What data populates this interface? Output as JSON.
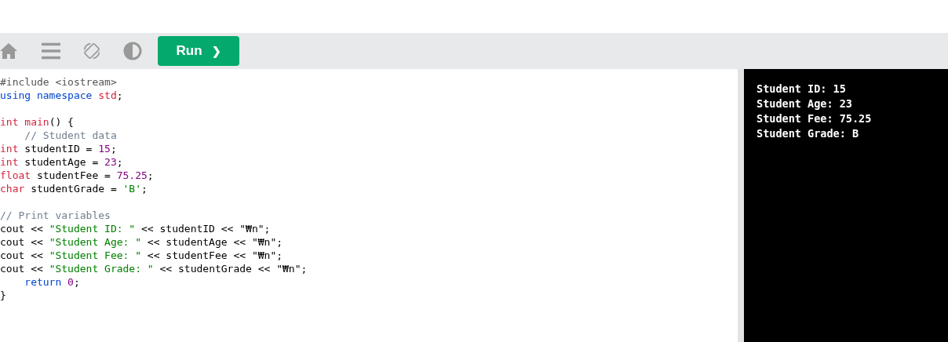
{
  "toolbar": {
    "buttons": [
      {
        "kind": "home"
      },
      {
        "kind": "menu"
      },
      {
        "kind": "rotate"
      },
      {
        "kind": "contrast"
      }
    ],
    "run_button": {
      "label": "Run",
      "icon": "❯"
    }
  },
  "editor": {
    "lines": [
      {
        "kind": "code",
        "tokens": [
          {
            "kind": "preproc",
            "text": "#include <iostream>"
          }
        ]
      },
      {
        "kind": "code",
        "tokens": [
          {
            "kind": "keyword",
            "text": "using namespace "
          },
          {
            "kind": "type",
            "text": "std"
          },
          {
            "kind": "plain",
            "text": ";"
          }
        ]
      },
      {
        "kind": "blank"
      },
      {
        "kind": "code",
        "tokens": [
          {
            "kind": "type",
            "text": "int main"
          },
          {
            "kind": "plain",
            "text": "() {"
          }
        ]
      },
      {
        "kind": "code",
        "tokens": [
          {
            "kind": "comment",
            "text": "    // Student data"
          }
        ]
      },
      {
        "kind": "code",
        "tokens": [
          {
            "kind": "type",
            "text": "int"
          },
          {
            "kind": "plain",
            "text": " studentID = "
          },
          {
            "kind": "number",
            "text": "15"
          },
          {
            "kind": "plain",
            "text": ";"
          }
        ]
      },
      {
        "kind": "code",
        "tokens": [
          {
            "kind": "type",
            "text": "int"
          },
          {
            "kind": "plain",
            "text": " studentAge = "
          },
          {
            "kind": "number",
            "text": "23"
          },
          {
            "kind": "plain",
            "text": ";"
          }
        ]
      },
      {
        "kind": "code",
        "tokens": [
          {
            "kind": "type",
            "text": "float"
          },
          {
            "kind": "plain",
            "text": " studentFee = "
          },
          {
            "kind": "number",
            "text": "75.25"
          },
          {
            "kind": "plain",
            "text": ";"
          }
        ]
      },
      {
        "kind": "code",
        "tokens": [
          {
            "kind": "type",
            "text": "char"
          },
          {
            "kind": "plain",
            "text": " studentGrade = "
          },
          {
            "kind": "string",
            "text": "'B'"
          },
          {
            "kind": "plain",
            "text": ";"
          }
        ]
      },
      {
        "kind": "blank"
      },
      {
        "kind": "code",
        "tokens": [
          {
            "kind": "comment",
            "text": "// Print variables"
          }
        ]
      },
      {
        "kind": "code",
        "tokens": [
          {
            "kind": "plain",
            "text": "cout << "
          },
          {
            "kind": "string",
            "text": "\"Student ID: \""
          },
          {
            "kind": "plain",
            "text": " << studentID << \"₩n\";"
          }
        ]
      },
      {
        "kind": "code",
        "tokens": [
          {
            "kind": "plain",
            "text": "cout << "
          },
          {
            "kind": "string",
            "text": "\"Student Age: \""
          },
          {
            "kind": "plain",
            "text": " << studentAge << \"₩n\";"
          }
        ]
      },
      {
        "kind": "code",
        "tokens": [
          {
            "kind": "plain",
            "text": "cout << "
          },
          {
            "kind": "string",
            "text": "\"Student Fee: \""
          },
          {
            "kind": "plain",
            "text": " << studentFee << \"₩n\";"
          }
        ]
      },
      {
        "kind": "code",
        "tokens": [
          {
            "kind": "plain",
            "text": "cout << "
          },
          {
            "kind": "string",
            "text": "\"Student Grade: \""
          },
          {
            "kind": "plain",
            "text": " << studentGrade << \"₩n\";"
          }
        ]
      },
      {
        "kind": "code",
        "tokens": [
          {
            "kind": "keyword",
            "text": "    return "
          },
          {
            "kind": "number",
            "text": "0"
          },
          {
            "kind": "plain",
            "text": ";"
          }
        ]
      },
      {
        "kind": "code",
        "tokens": [
          {
            "kind": "plain",
            "text": "}"
          }
        ]
      }
    ]
  },
  "output": {
    "lines": [
      "Student ID: 15",
      "Student Age: 23",
      "Student Fee: 75.25",
      "Student Grade: B"
    ]
  }
}
